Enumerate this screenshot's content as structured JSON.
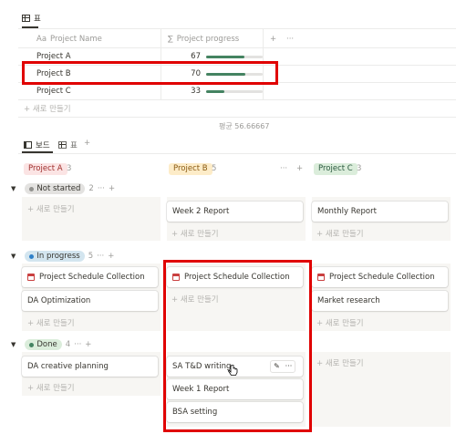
{
  "table_view": {
    "tab_label": "표",
    "headers": {
      "name": "Project Name",
      "name_icon": "Aa",
      "progress": "Project progress",
      "progress_icon": "∑",
      "add": "+",
      "more": "···"
    },
    "rows": [
      {
        "name": "Project A",
        "progress": "67",
        "fraction": 0.67
      },
      {
        "name": "Project B",
        "progress": "70",
        "fraction": 0.7
      },
      {
        "name": "Project C",
        "progress": "33",
        "fraction": 0.33
      }
    ],
    "new_row": "+ 새로 만들기",
    "average": "평균 56.66667"
  },
  "board_view": {
    "tabs": [
      {
        "label": "보드"
      },
      {
        "label": "표"
      }
    ],
    "add_view": "+",
    "columns": [
      {
        "name": "Project A",
        "count": "3",
        "color": "#fbe4e4",
        "text_color": "#9f2f2d"
      },
      {
        "name": "Project B",
        "count": "5",
        "color": "#fdecc8",
        "text_color": "#8a5a12"
      },
      {
        "name": "Project C",
        "count": "3",
        "color": "#dbeddb",
        "text_color": "#2b593f"
      }
    ],
    "column_actions": {
      "more": "···",
      "add": "+"
    },
    "groups": [
      {
        "name": "Not started",
        "count": "2",
        "dot": "#91918e",
        "bg": "#e3e2e0"
      },
      {
        "name": "In progress",
        "count": "5",
        "dot": "#2f80c9",
        "bg": "#d3e5ef"
      },
      {
        "name": "Done",
        "count": "4",
        "dot": "#448361",
        "bg": "#dbeddb"
      }
    ],
    "group_actions": {
      "more": "···",
      "add": "+"
    },
    "cards": {
      "ns_a_new": "+ 새로 만들기",
      "ns_b_card": "Week 2 Report",
      "ns_b_new": "+ 새로 만들기",
      "ns_c_card": "Monthly Report",
      "ns_c_new": "+ 새로 만들기",
      "ip_a_card1": "Project Schedule Collection",
      "ip_a_card2": "DA Optimization",
      "ip_a_new": "+ 새로 만들기",
      "ip_b_card1": "Project Schedule Collection",
      "ip_b_new": "+ 새로 만들기",
      "ip_c_card1": "Project Schedule Collection",
      "ip_c_card2": "Market research",
      "ip_c_new": "+ 새로 만들기",
      "d_a_card1": "DA creative planning",
      "d_a_new": "+ 새로 만들기",
      "d_b_card1": "SA T&D writing",
      "d_b_card2": "Week 1 Report",
      "d_b_card3": "BSA setting",
      "d_c_new": "+ 새로 만들기"
    },
    "card_actions": {
      "edit": "✎",
      "more": "···"
    }
  }
}
